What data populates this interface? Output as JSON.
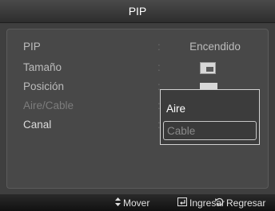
{
  "window": {
    "title": "PIP"
  },
  "menu": {
    "rows": [
      {
        "label": "PIP",
        "value": "Encendido",
        "state": "normal"
      },
      {
        "label": "Tamaño",
        "value_icon": "pip-size-icon",
        "state": "normal"
      },
      {
        "label": "Posición",
        "value_icon": "pip-position-icon",
        "state": "normal"
      },
      {
        "label": "Aire/Cable",
        "state": "disabled"
      },
      {
        "label": "Canal",
        "state": "active"
      }
    ],
    "separator": ":"
  },
  "dropdown": {
    "options": [
      {
        "label": "Aire",
        "selected": false
      },
      {
        "label": "Cable",
        "selected": true
      }
    ]
  },
  "hints": {
    "move": {
      "icon": "updown-arrows-icon",
      "label": "Mover"
    },
    "enter": {
      "icon": "enter-icon",
      "label": "Ingresar"
    },
    "return": {
      "icon": "return-icon",
      "label": "Regresar"
    }
  },
  "colors": {
    "background": "#3f3f3f",
    "panel": "#484848",
    "text": "#bcbcbc",
    "text_disabled": "#7d7d7d"
  }
}
